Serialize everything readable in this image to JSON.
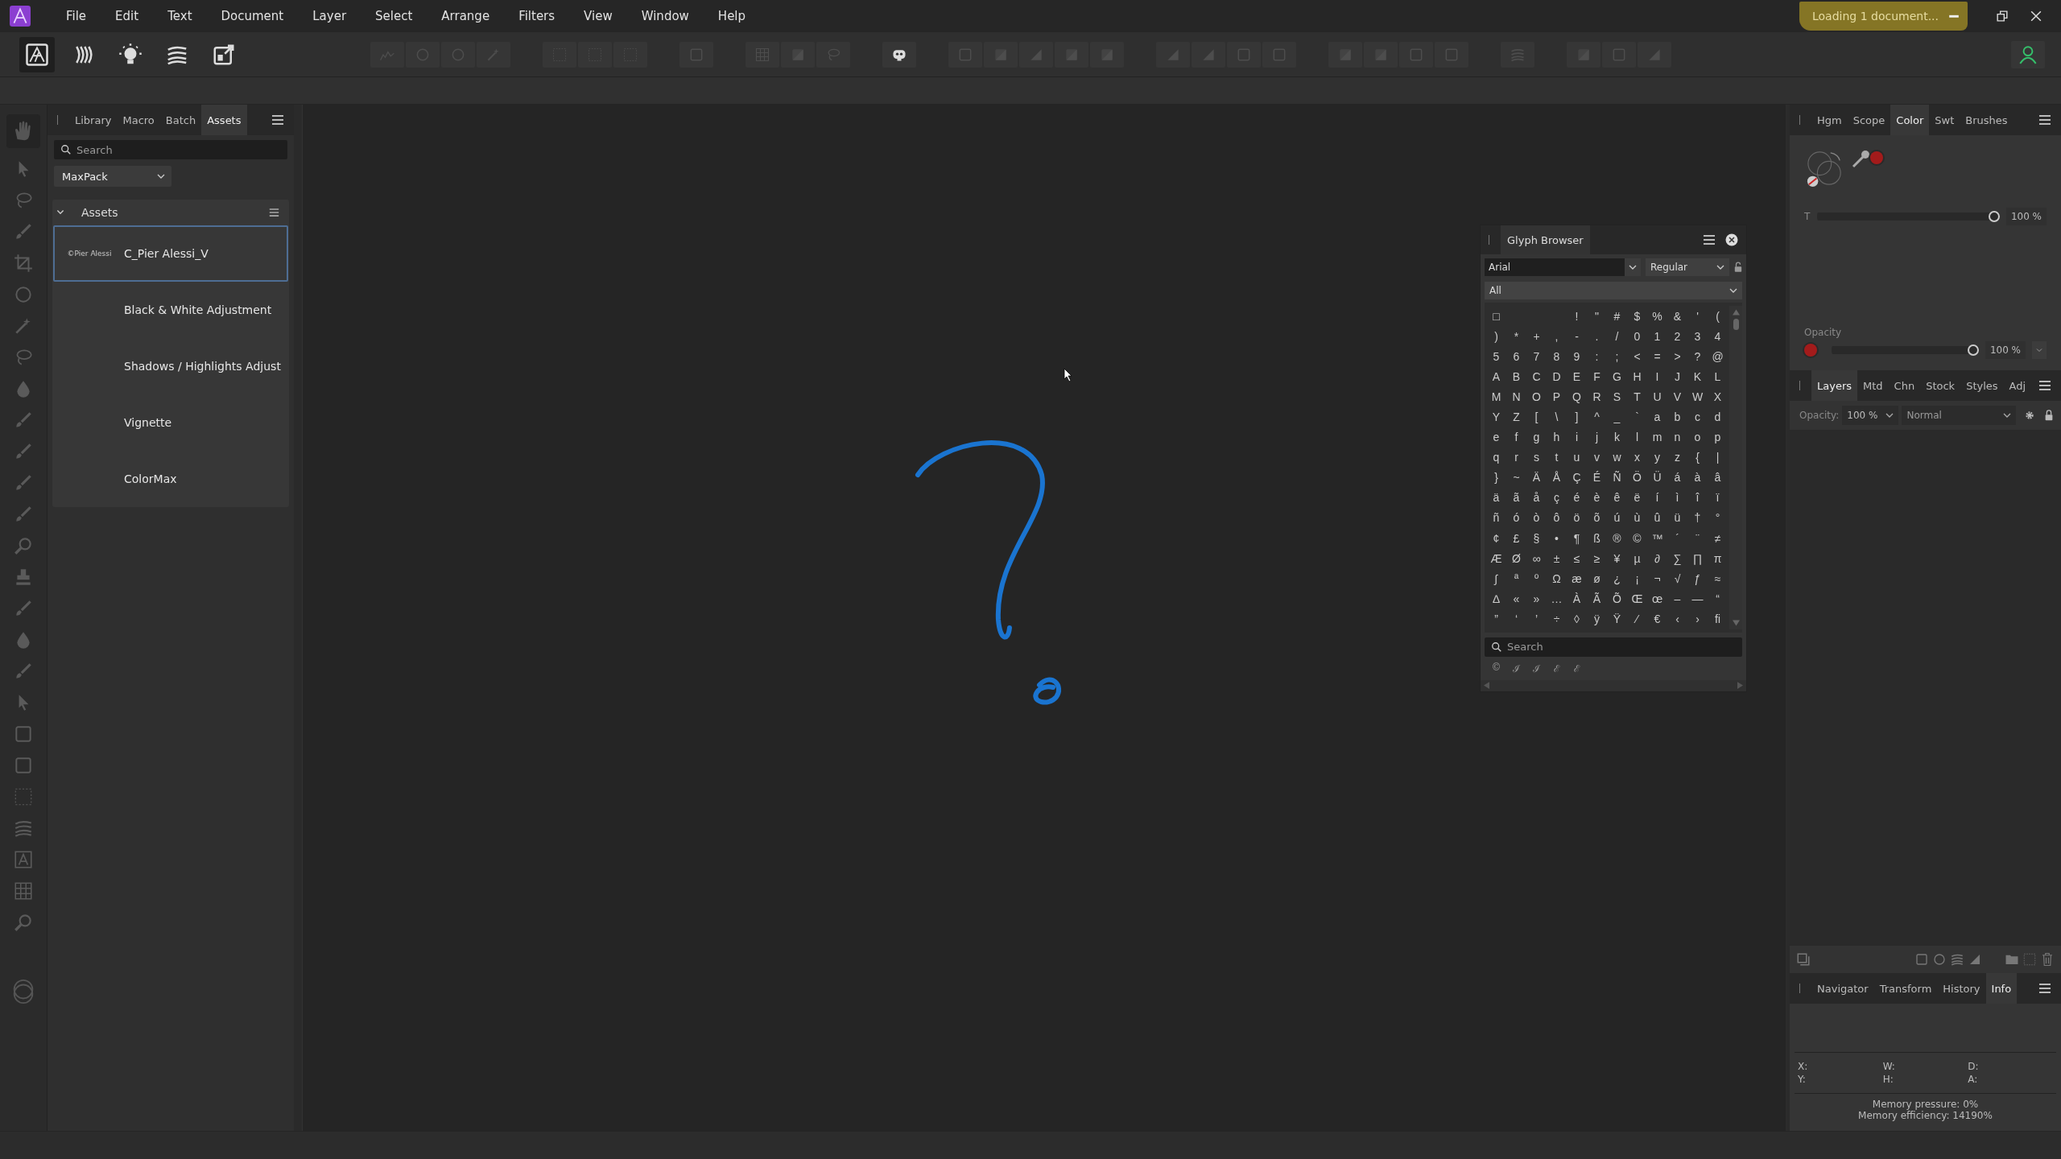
{
  "menu": [
    "File",
    "Edit",
    "Text",
    "Document",
    "Layer",
    "Select",
    "Arrange",
    "Filters",
    "View",
    "Window",
    "Help"
  ],
  "loading": {
    "label": "Loading 1 document..."
  },
  "left_panel": {
    "tabs": [
      {
        "label": "Library",
        "selected": false
      },
      {
        "label": "Macro",
        "selected": false
      },
      {
        "label": "Batch",
        "selected": false
      },
      {
        "label": "Assets",
        "selected": true
      }
    ],
    "search": {
      "placeholder": "Search"
    },
    "category": "MaxPack",
    "section": {
      "title": "Assets",
      "expanded": true,
      "items": [
        {
          "name": "C_Pier Alessi_V",
          "thumbnail": "©Pier Alessi",
          "selected": true
        },
        {
          "name": "Black & White Adjustment",
          "selected": false
        },
        {
          "name": "Shadows / Highlights Adjust",
          "selected": false
        },
        {
          "name": "Vignette",
          "selected": false
        },
        {
          "name": "ColorMax",
          "selected": false
        }
      ]
    }
  },
  "glyph_browser": {
    "title": "Glyph Browser",
    "font": "Arial",
    "style": "Regular",
    "subset": "All",
    "glyph_rows": [
      [
        "□",
        null,
        null,
        null,
        "!",
        "\"",
        "#",
        "$",
        "%",
        "&",
        "'",
        "("
      ],
      [
        ")",
        "*",
        "+",
        ",",
        "-",
        ".",
        "/",
        "0",
        "1",
        "2",
        "3",
        "4"
      ],
      [
        "5",
        "6",
        "7",
        "8",
        "9",
        ":",
        ";",
        "<",
        "=",
        ">",
        "?",
        "@"
      ],
      [
        "A",
        "B",
        "C",
        "D",
        "E",
        "F",
        "G",
        "H",
        "I",
        "J",
        "K",
        "L"
      ],
      [
        "M",
        "N",
        "O",
        "P",
        "Q",
        "R",
        "S",
        "T",
        "U",
        "V",
        "W",
        "X"
      ],
      [
        "Y",
        "Z",
        "[",
        "\\",
        "]",
        "^",
        "_",
        "`",
        "a",
        "b",
        "c",
        "d"
      ],
      [
        "e",
        "f",
        "g",
        "h",
        "i",
        "j",
        "k",
        "l",
        "m",
        "n",
        "o",
        "p"
      ],
      [
        "q",
        "r",
        "s",
        "t",
        "u",
        "v",
        "w",
        "x",
        "y",
        "z",
        "{",
        "|"
      ],
      [
        "}",
        "~",
        "Ä",
        "Å",
        "Ç",
        "É",
        "Ñ",
        "Ö",
        "Ü",
        "á",
        "à",
        "â"
      ],
      [
        "ä",
        "ã",
        "å",
        "ç",
        "é",
        "è",
        "ê",
        "ë",
        "í",
        "ì",
        "î",
        "ï"
      ],
      [
        "ñ",
        "ó",
        "ò",
        "ô",
        "ö",
        "õ",
        "ú",
        "ù",
        "û",
        "ü",
        "†",
        "°"
      ],
      [
        "¢",
        "£",
        "§",
        "•",
        "¶",
        "ß",
        "®",
        "©",
        "™",
        "´",
        "¨",
        "≠"
      ],
      [
        "Æ",
        "Ø",
        "∞",
        "±",
        "≤",
        "≥",
        "¥",
        "µ",
        "∂",
        "∑",
        "∏",
        "π"
      ],
      [
        "∫",
        "ª",
        "º",
        "Ω",
        "æ",
        "ø",
        "¿",
        "¡",
        "¬",
        "√",
        "ƒ",
        "≈"
      ],
      [
        "∆",
        "«",
        "»",
        "…",
        "À",
        "Ã",
        "Õ",
        "Œ",
        "œ",
        "–",
        "—",
        "“"
      ],
      [
        "”",
        "‘",
        "’",
        "÷",
        "◊",
        "ÿ",
        "Ÿ",
        "⁄",
        "€",
        "‹",
        "›",
        "ﬁ"
      ]
    ],
    "search": {
      "placeholder": "Search"
    },
    "recent": [
      "©",
      "ℐ",
      "ℐ",
      "ℰ",
      "ℰ"
    ]
  },
  "color_panel": {
    "tabs": [
      {
        "label": "Hgm",
        "selected": false
      },
      {
        "label": "Scope",
        "selected": false
      },
      {
        "label": "Color",
        "selected": true
      },
      {
        "label": "Swt",
        "selected": false
      },
      {
        "label": "Brushes",
        "selected": false
      }
    ],
    "fill": {
      "color": "#a31b1b"
    },
    "tint": {
      "label": "T",
      "level": 1,
      "reading": "100 %"
    },
    "opacity": {
      "label": "Opacity",
      "color": "#a31b1b",
      "level": 1,
      "reading": "100 %"
    }
  },
  "layers_panel": {
    "tabs": [
      {
        "label": "Layers",
        "selected": true
      },
      {
        "label": "Mtd",
        "selected": false
      },
      {
        "label": "Chn",
        "selected": false
      },
      {
        "label": "Stock",
        "selected": false
      },
      {
        "label": "Styles",
        "selected": false
      },
      {
        "label": "Adj",
        "selected": false
      }
    ],
    "opacity_label": "Opacity:",
    "opacity": "100 %",
    "blend_mode": "Normal"
  },
  "info_panel": {
    "tabs": [
      {
        "label": "Navigator",
        "selected": false
      },
      {
        "label": "Transform",
        "selected": false
      },
      {
        "label": "History",
        "selected": false
      },
      {
        "label": "Info",
        "selected": true
      }
    ],
    "fields": [
      "X:",
      "W:",
      "D:",
      "Y:",
      "H:",
      "A:"
    ],
    "memory_pressure": "Memory pressure: 0%",
    "memory_efficiency": "Memory efficiency: 14190%"
  }
}
